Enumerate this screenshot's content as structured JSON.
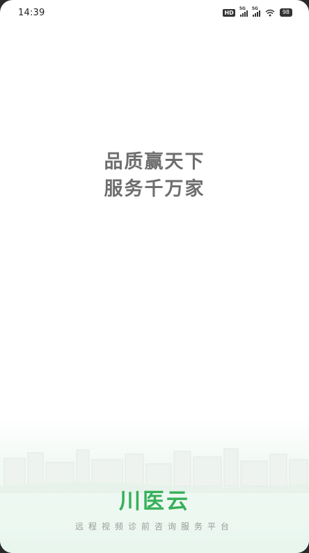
{
  "status_bar": {
    "time": "14:39",
    "hd_label": "HD",
    "network1": "5G",
    "network2": "5G",
    "battery": "98"
  },
  "slogan": {
    "line1": "品质赢天下",
    "line2": "服务千万家"
  },
  "brand": {
    "logo": "川医云",
    "tagline": "远程视频诊前咨询服务平台",
    "accent_color": "#36b05a"
  }
}
